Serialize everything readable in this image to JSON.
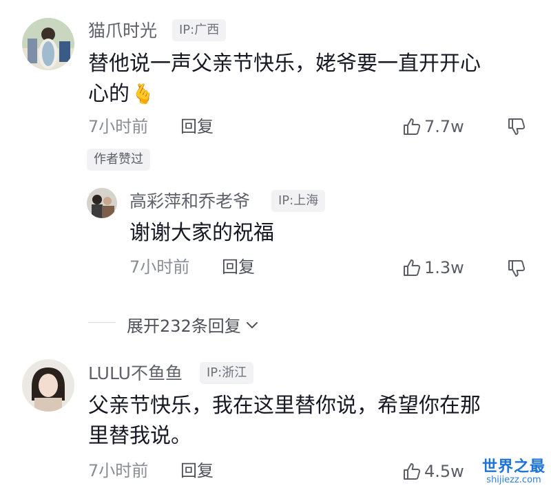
{
  "comments": [
    {
      "author": "猫爪时光",
      "ip": "IP:广西",
      "content_line1": "替他说一声父亲节快乐，姥爷要一直开开心",
      "content_line2": "心的",
      "emoji": "🫰",
      "time": "7小时前",
      "reply_label": "回复",
      "likes": "7.7w",
      "author_liked": "作者赞过",
      "icons": {
        "like": "thumb-up-icon",
        "dislike": "thumb-down-icon"
      }
    },
    {
      "author": "LULU不鱼鱼",
      "ip": "IP:浙江",
      "content_line1": "父亲节快乐，我在这里替你说，希望你在那",
      "content_line2": "里替我说。",
      "time": "7小时前",
      "reply_label": "回复",
      "likes": "4.5w",
      "icons": {
        "like": "thumb-up-icon"
      }
    }
  ],
  "reply": {
    "author": "高彩萍和乔老爷",
    "ip": "IP:上海",
    "content": "谢谢大家的祝福",
    "time": "7小时前",
    "reply_label": "回复",
    "likes": "1.3w",
    "icons": {
      "like": "thumb-up-icon",
      "dislike": "thumb-down-icon"
    }
  },
  "expand_replies": {
    "label": "展开232条回复",
    "icon": "chevron-down-icon"
  },
  "watermark": {
    "title": "世界之最",
    "url": "shijiezz.com"
  },
  "colors": {
    "text_primary": "#161823",
    "text_secondary": "#5f616b",
    "badge_bg": "#f2f2f4",
    "watermark_blue": "#1e73d8"
  }
}
